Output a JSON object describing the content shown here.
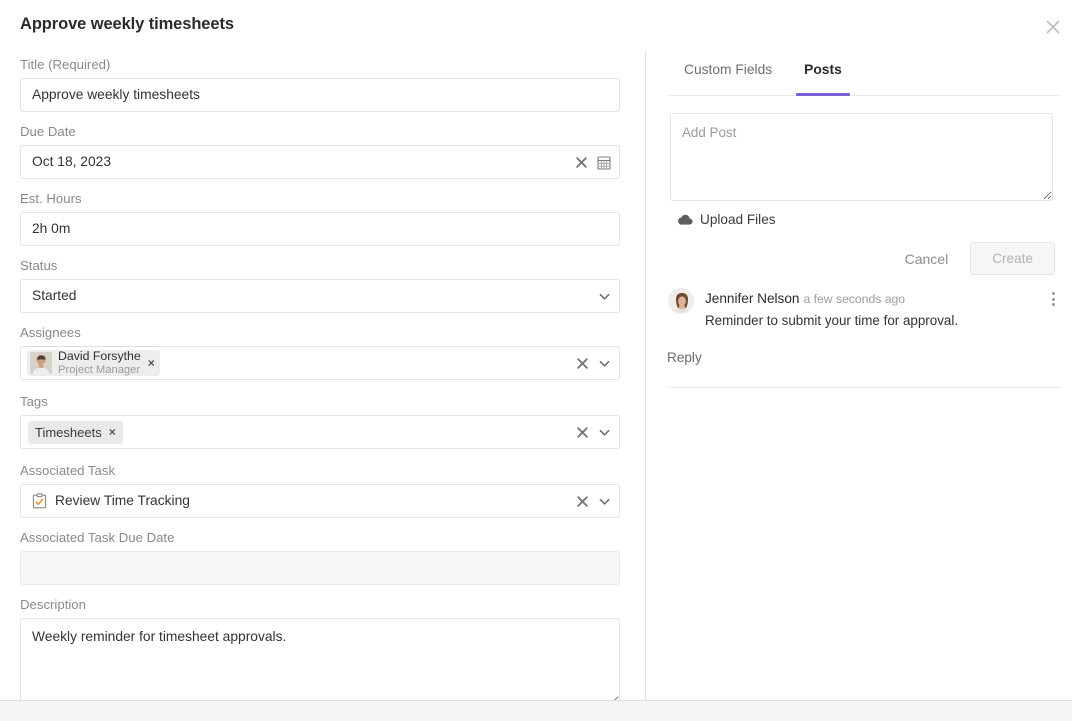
{
  "header": {
    "title": "Approve weekly timesheets",
    "close_icon": "close-icon"
  },
  "form": {
    "title_field": {
      "label": "Title (Required)",
      "value": "Approve weekly timesheets"
    },
    "due_date_field": {
      "label": "Due Date",
      "value": "Oct 18, 2023",
      "clear_icon": "clear-x-icon",
      "calendar_icon": "calendar-icon"
    },
    "est_hours_field": {
      "label": "Est. Hours",
      "value": "2h 0m"
    },
    "status_field": {
      "label": "Status",
      "value": "Started",
      "caret_icon": "chevron-down-icon"
    },
    "assignees_field": {
      "label": "Assignees",
      "chip": {
        "name": "David Forsythe",
        "role": "Project Manager",
        "remove": "×"
      },
      "clear_icon": "clear-x-icon",
      "caret_icon": "chevron-down-icon"
    },
    "tags_field": {
      "label": "Tags",
      "chip": {
        "label": "Timesheets",
        "remove": "×"
      },
      "clear_icon": "clear-x-icon",
      "caret_icon": "chevron-down-icon"
    },
    "associated_task_field": {
      "label": "Associated Task",
      "value": "Review Time Tracking",
      "task_icon": "clipboard-check-icon",
      "clear_icon": "clear-x-icon",
      "caret_icon": "chevron-down-icon"
    },
    "associated_task_due_date_field": {
      "label": "Associated Task Due Date",
      "value": "",
      "disabled": true
    },
    "description_field": {
      "label": "Description",
      "value": "Weekly reminder for timesheet approvals."
    }
  },
  "right_panel": {
    "tabs": [
      {
        "label": "Custom Fields",
        "active": false
      },
      {
        "label": "Posts",
        "active": true
      }
    ],
    "add_post": {
      "placeholder": "Add Post",
      "value": ""
    },
    "upload": {
      "label": "Upload Files",
      "icon": "cloud-upload-icon"
    },
    "actions": {
      "cancel_label": "Cancel",
      "create_label": "Create"
    },
    "posts": [
      {
        "author": "Jennifer Nelson",
        "time": "a few seconds ago",
        "text": "Reminder to submit your time for approval.",
        "menu_icon": "more-vertical-icon"
      }
    ],
    "reply_label": "Reply"
  },
  "colors": {
    "accent": "#7b61d8",
    "text_primary": "#2b2b2b",
    "text_muted": "#8a8a8a",
    "border": "#e2e2e2",
    "task_icon_accent": "#f28c28"
  }
}
